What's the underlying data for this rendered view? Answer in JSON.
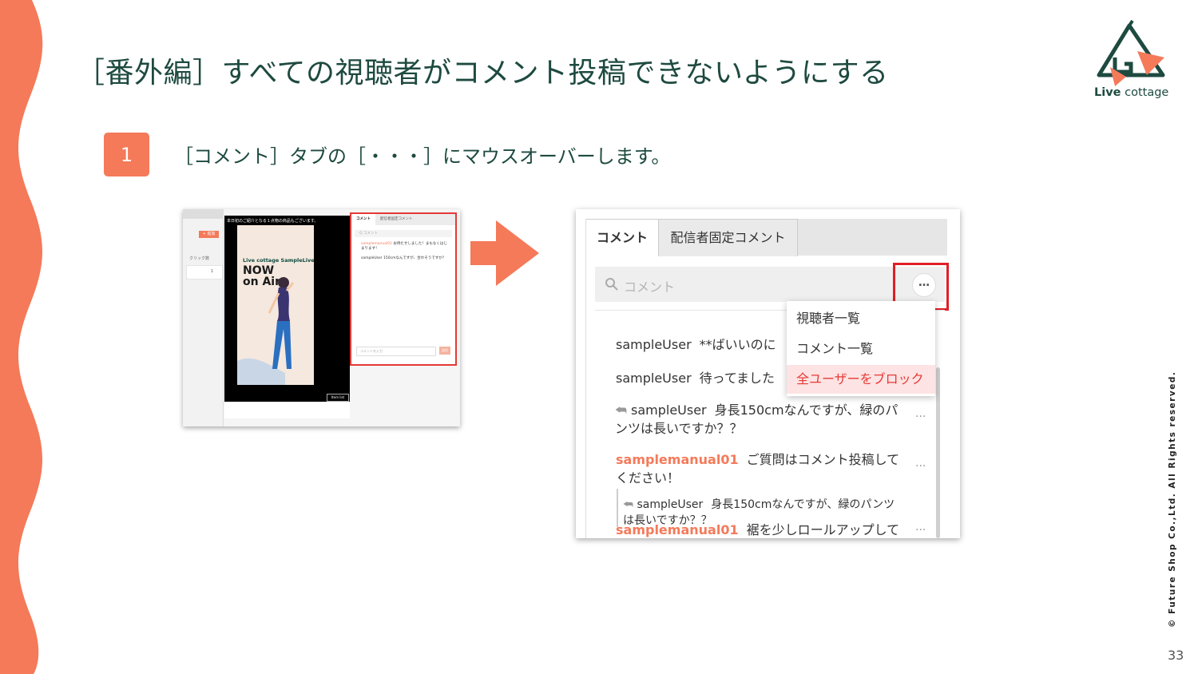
{
  "slide": {
    "title": "［番外編］すべての視聴者がコメント投稿できないようにする",
    "step_number": "1",
    "step_text": "［コメント］タブの［・・・］にマウスオーバーします。",
    "copyright": "© Future Shop Co.,Ltd. All Rights reserved.",
    "page_number": "33"
  },
  "logo": {
    "text_bold": "Live",
    "text_rest": " cottage"
  },
  "colors": {
    "accent": "#f47a5a",
    "title": "#1e4a40",
    "highlight": "#e01e26"
  },
  "thumb": {
    "add_label": "+ 追加",
    "click_label": "クリック数",
    "row_value": "1",
    "video_top_text": "本日初のご紹介となる１点物の商品もございます。",
    "poster_line1": "Live cottage SampleLive",
    "poster_line2": "NOW",
    "poster_line3": "on Air",
    "item_label": "Item list",
    "tab_comment": "コメント",
    "tab_pinned": "配信者固定コメント",
    "search_placeholder": "Q コメント",
    "msg1_user": "samplemanual01",
    "msg1_text": "お待たせしました！まもなくはじまります！",
    "msg2_user": "sampleUser",
    "msg2_text": "150cmなんですが、合わそうですか？",
    "input_placeholder": "コメントを入力",
    "send_label": "送信"
  },
  "zoom": {
    "tab_comment": "コメント",
    "tab_pinned": "配信者固定コメント",
    "search_placeholder": "コメント",
    "more_label": "…",
    "menu": [
      "視聴者一覧",
      "コメント一覧",
      "全ユーザーをブロック"
    ],
    "messages": [
      {
        "user": "sampleUser",
        "text": "**ばいいのに"
      },
      {
        "user": "sampleUser",
        "text": "待ってました"
      },
      {
        "reply_icon": "reply-icon",
        "user": "sampleUser",
        "text": "身長150cmなんですが、緑のパ",
        "text2": "ンツは長いですか？？"
      },
      {
        "user": "samplemanual01",
        "text": "ご質問はコメント投稿して",
        "text2": "ください！"
      },
      {
        "reply_icon": "reply-icon",
        "user": "sampleUser",
        "text": "身長150cmなんですが、緑のパンツ",
        "text2": "は長いですか？？"
      },
      {
        "user": "samplemanual01",
        "text": "裾を少しロールアップして"
      }
    ]
  }
}
